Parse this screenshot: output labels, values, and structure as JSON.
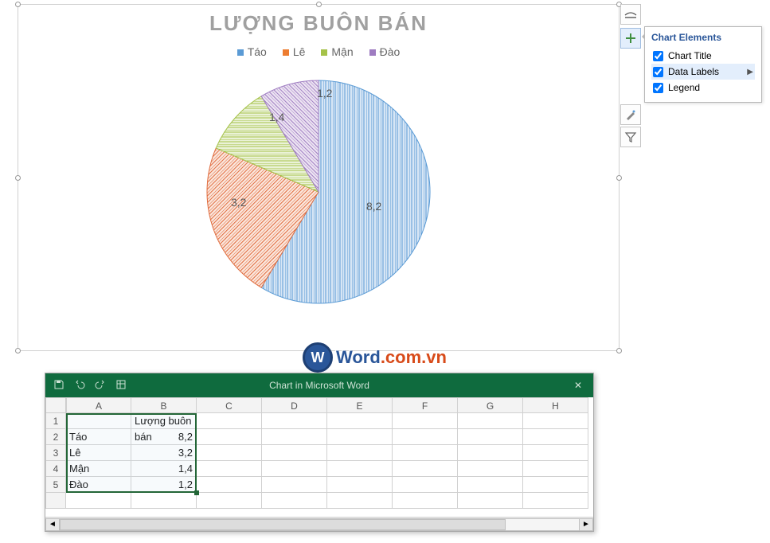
{
  "chart_data": {
    "type": "pie",
    "title": "LƯỢNG BUÔN BÁN",
    "categories": [
      "Táo",
      "Lê",
      "Mận",
      "Đào"
    ],
    "values": [
      8.2,
      3.2,
      1.4,
      1.2
    ],
    "labels": [
      "8,2",
      "3,2",
      "1,4",
      "1,2"
    ]
  },
  "legend": {
    "items": [
      {
        "label": "Táo",
        "color": "#5b9bd5"
      },
      {
        "label": "Lê",
        "color": "#ed7d31"
      },
      {
        "label": "Mận",
        "color": "#a5c249"
      },
      {
        "label": "Đào",
        "color": "#9e7cc1"
      }
    ]
  },
  "chart_elements_panel": {
    "title": "Chart Elements",
    "options": [
      {
        "label": "Chart Title",
        "checked": true,
        "highlight": false,
        "arrow": false
      },
      {
        "label": "Data Labels",
        "checked": true,
        "highlight": true,
        "arrow": true
      },
      {
        "label": "Legend",
        "checked": true,
        "highlight": false,
        "arrow": false
      }
    ]
  },
  "watermark": {
    "badge": "W",
    "left": "Word",
    "right": ".com.vn"
  },
  "mini_excel": {
    "title": "Chart in Microsoft Word",
    "columns": [
      "A",
      "B",
      "C",
      "D",
      "E",
      "F",
      "G",
      "H"
    ],
    "header_cell": "Lượng buôn bán",
    "rows": [
      [
        "Táo",
        "8,2"
      ],
      [
        "Lê",
        "3,2"
      ],
      [
        "Mận",
        "1,4"
      ],
      [
        "Đào",
        "1,2"
      ]
    ]
  }
}
